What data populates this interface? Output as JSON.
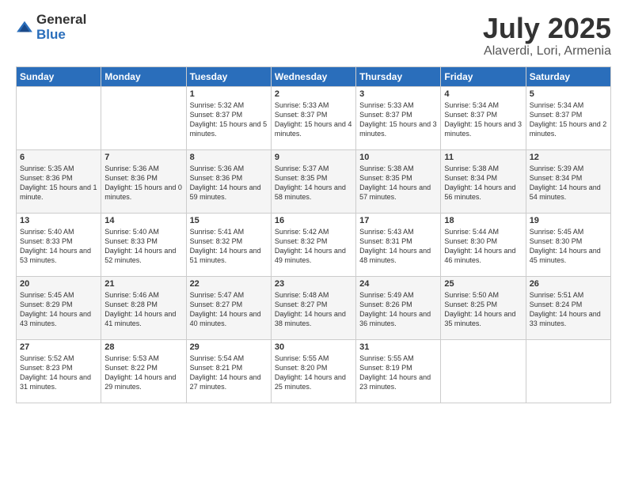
{
  "logo": {
    "general": "General",
    "blue": "Blue"
  },
  "title": "July 2025",
  "subtitle": "Alaverdi, Lori, Armenia",
  "days_of_week": [
    "Sunday",
    "Monday",
    "Tuesday",
    "Wednesday",
    "Thursday",
    "Friday",
    "Saturday"
  ],
  "weeks": [
    [
      {
        "day": "",
        "sunrise": "",
        "sunset": "",
        "daylight": ""
      },
      {
        "day": "",
        "sunrise": "",
        "sunset": "",
        "daylight": ""
      },
      {
        "day": "1",
        "sunrise": "Sunrise: 5:32 AM",
        "sunset": "Sunset: 8:37 PM",
        "daylight": "Daylight: 15 hours and 5 minutes."
      },
      {
        "day": "2",
        "sunrise": "Sunrise: 5:33 AM",
        "sunset": "Sunset: 8:37 PM",
        "daylight": "Daylight: 15 hours and 4 minutes."
      },
      {
        "day": "3",
        "sunrise": "Sunrise: 5:33 AM",
        "sunset": "Sunset: 8:37 PM",
        "daylight": "Daylight: 15 hours and 3 minutes."
      },
      {
        "day": "4",
        "sunrise": "Sunrise: 5:34 AM",
        "sunset": "Sunset: 8:37 PM",
        "daylight": "Daylight: 15 hours and 3 minutes."
      },
      {
        "day": "5",
        "sunrise": "Sunrise: 5:34 AM",
        "sunset": "Sunset: 8:37 PM",
        "daylight": "Daylight: 15 hours and 2 minutes."
      }
    ],
    [
      {
        "day": "6",
        "sunrise": "Sunrise: 5:35 AM",
        "sunset": "Sunset: 8:36 PM",
        "daylight": "Daylight: 15 hours and 1 minute."
      },
      {
        "day": "7",
        "sunrise": "Sunrise: 5:36 AM",
        "sunset": "Sunset: 8:36 PM",
        "daylight": "Daylight: 15 hours and 0 minutes."
      },
      {
        "day": "8",
        "sunrise": "Sunrise: 5:36 AM",
        "sunset": "Sunset: 8:36 PM",
        "daylight": "Daylight: 14 hours and 59 minutes."
      },
      {
        "day": "9",
        "sunrise": "Sunrise: 5:37 AM",
        "sunset": "Sunset: 8:35 PM",
        "daylight": "Daylight: 14 hours and 58 minutes."
      },
      {
        "day": "10",
        "sunrise": "Sunrise: 5:38 AM",
        "sunset": "Sunset: 8:35 PM",
        "daylight": "Daylight: 14 hours and 57 minutes."
      },
      {
        "day": "11",
        "sunrise": "Sunrise: 5:38 AM",
        "sunset": "Sunset: 8:34 PM",
        "daylight": "Daylight: 14 hours and 56 minutes."
      },
      {
        "day": "12",
        "sunrise": "Sunrise: 5:39 AM",
        "sunset": "Sunset: 8:34 PM",
        "daylight": "Daylight: 14 hours and 54 minutes."
      }
    ],
    [
      {
        "day": "13",
        "sunrise": "Sunrise: 5:40 AM",
        "sunset": "Sunset: 8:33 PM",
        "daylight": "Daylight: 14 hours and 53 minutes."
      },
      {
        "day": "14",
        "sunrise": "Sunrise: 5:40 AM",
        "sunset": "Sunset: 8:33 PM",
        "daylight": "Daylight: 14 hours and 52 minutes."
      },
      {
        "day": "15",
        "sunrise": "Sunrise: 5:41 AM",
        "sunset": "Sunset: 8:32 PM",
        "daylight": "Daylight: 14 hours and 51 minutes."
      },
      {
        "day": "16",
        "sunrise": "Sunrise: 5:42 AM",
        "sunset": "Sunset: 8:32 PM",
        "daylight": "Daylight: 14 hours and 49 minutes."
      },
      {
        "day": "17",
        "sunrise": "Sunrise: 5:43 AM",
        "sunset": "Sunset: 8:31 PM",
        "daylight": "Daylight: 14 hours and 48 minutes."
      },
      {
        "day": "18",
        "sunrise": "Sunrise: 5:44 AM",
        "sunset": "Sunset: 8:30 PM",
        "daylight": "Daylight: 14 hours and 46 minutes."
      },
      {
        "day": "19",
        "sunrise": "Sunrise: 5:45 AM",
        "sunset": "Sunset: 8:30 PM",
        "daylight": "Daylight: 14 hours and 45 minutes."
      }
    ],
    [
      {
        "day": "20",
        "sunrise": "Sunrise: 5:45 AM",
        "sunset": "Sunset: 8:29 PM",
        "daylight": "Daylight: 14 hours and 43 minutes."
      },
      {
        "day": "21",
        "sunrise": "Sunrise: 5:46 AM",
        "sunset": "Sunset: 8:28 PM",
        "daylight": "Daylight: 14 hours and 41 minutes."
      },
      {
        "day": "22",
        "sunrise": "Sunrise: 5:47 AM",
        "sunset": "Sunset: 8:27 PM",
        "daylight": "Daylight: 14 hours and 40 minutes."
      },
      {
        "day": "23",
        "sunrise": "Sunrise: 5:48 AM",
        "sunset": "Sunset: 8:27 PM",
        "daylight": "Daylight: 14 hours and 38 minutes."
      },
      {
        "day": "24",
        "sunrise": "Sunrise: 5:49 AM",
        "sunset": "Sunset: 8:26 PM",
        "daylight": "Daylight: 14 hours and 36 minutes."
      },
      {
        "day": "25",
        "sunrise": "Sunrise: 5:50 AM",
        "sunset": "Sunset: 8:25 PM",
        "daylight": "Daylight: 14 hours and 35 minutes."
      },
      {
        "day": "26",
        "sunrise": "Sunrise: 5:51 AM",
        "sunset": "Sunset: 8:24 PM",
        "daylight": "Daylight: 14 hours and 33 minutes."
      }
    ],
    [
      {
        "day": "27",
        "sunrise": "Sunrise: 5:52 AM",
        "sunset": "Sunset: 8:23 PM",
        "daylight": "Daylight: 14 hours and 31 minutes."
      },
      {
        "day": "28",
        "sunrise": "Sunrise: 5:53 AM",
        "sunset": "Sunset: 8:22 PM",
        "daylight": "Daylight: 14 hours and 29 minutes."
      },
      {
        "day": "29",
        "sunrise": "Sunrise: 5:54 AM",
        "sunset": "Sunset: 8:21 PM",
        "daylight": "Daylight: 14 hours and 27 minutes."
      },
      {
        "day": "30",
        "sunrise": "Sunrise: 5:55 AM",
        "sunset": "Sunset: 8:20 PM",
        "daylight": "Daylight: 14 hours and 25 minutes."
      },
      {
        "day": "31",
        "sunrise": "Sunrise: 5:55 AM",
        "sunset": "Sunset: 8:19 PM",
        "daylight": "Daylight: 14 hours and 23 minutes."
      },
      {
        "day": "",
        "sunrise": "",
        "sunset": "",
        "daylight": ""
      },
      {
        "day": "",
        "sunrise": "",
        "sunset": "",
        "daylight": ""
      }
    ]
  ]
}
